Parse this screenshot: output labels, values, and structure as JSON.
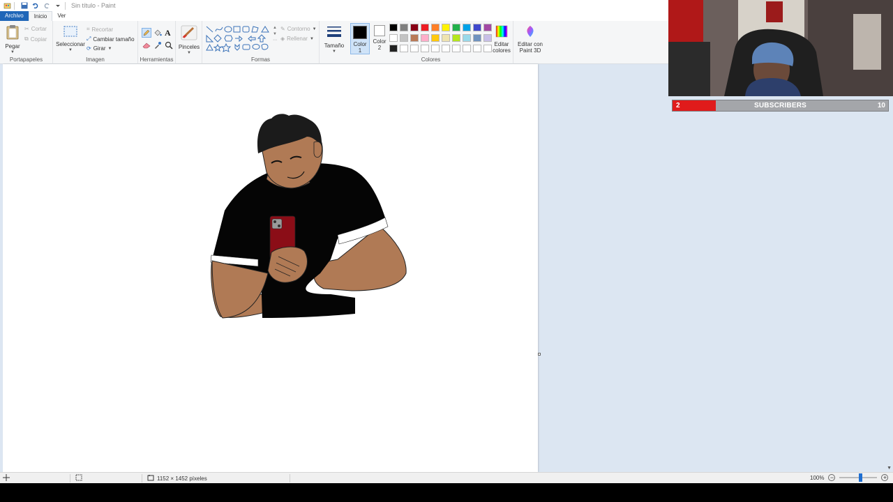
{
  "window": {
    "title": "Sin título - Paint"
  },
  "tabs": [
    {
      "label": "Archivo"
    },
    {
      "label": "Inicio"
    },
    {
      "label": "Ver"
    }
  ],
  "ribbon": {
    "clipboard": {
      "paste": "Pegar",
      "cut": "Cortar",
      "copy": "Copiar",
      "group": "Portapapeles"
    },
    "image": {
      "select": "Seleccionar",
      "crop": "Recortar",
      "resize": "Cambiar tamaño",
      "rotate": "Girar",
      "group": "Imagen"
    },
    "tools": {
      "group": "Herramientas"
    },
    "brushes": {
      "label": "Pinceles"
    },
    "shapes": {
      "outline": "Contorno",
      "fill": "Rellenar",
      "group": "Formas"
    },
    "size": {
      "label": "Tamaño"
    },
    "colors": {
      "color1": "Color 1",
      "color2": "Color 2",
      "edit": "Editar colores",
      "paint3d": "Editar con Paint 3D",
      "group": "Colores",
      "color1_value": "#000000",
      "color2_value": "#ffffff",
      "palette_row1": [
        "#000000",
        "#7f7f7f",
        "#880015",
        "#ed1c24",
        "#ff7f27",
        "#fff200",
        "#22b14c",
        "#00a2e8",
        "#3f48cc",
        "#a349a4"
      ],
      "palette_row2": [
        "#ffffff",
        "#c3c3c3",
        "#b97a57",
        "#ffaec9",
        "#ffc90e",
        "#efe4b0",
        "#b5e61d",
        "#99d9ea",
        "#7092be",
        "#c8bfe7"
      ],
      "palette_row3": [
        "#222222",
        "#ffffff",
        "#ffffff",
        "#ffffff",
        "#ffffff",
        "#ffffff",
        "#ffffff",
        "#ffffff",
        "#ffffff",
        "#ffffff"
      ]
    }
  },
  "status": {
    "dimensions": "1152 × 1452 píxeles",
    "zoom": "100%"
  },
  "overlay": {
    "subscribers_count": "2",
    "subscribers_label": "SUBSCRIBERS",
    "subscribers_goal": "10"
  }
}
